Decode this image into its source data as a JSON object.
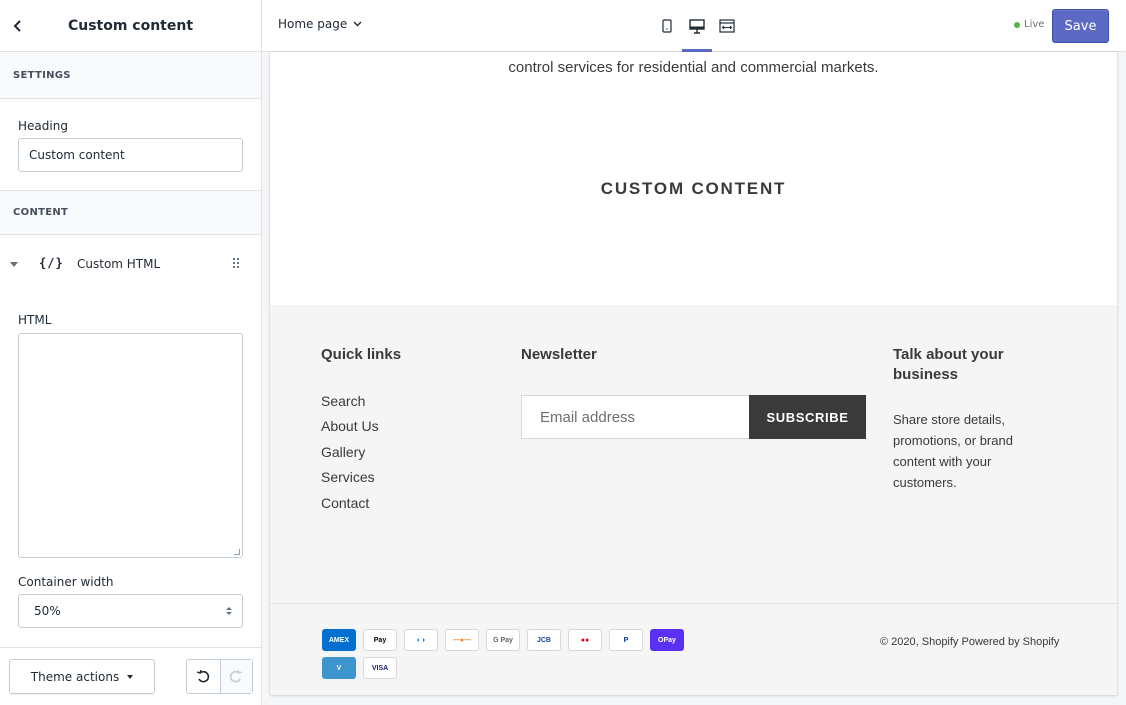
{
  "sidebar": {
    "title": "Custom content",
    "settings_label": "SETTINGS",
    "heading_label": "Heading",
    "heading_value": "Custom content",
    "content_label": "CONTENT",
    "block_glyph": "{/}",
    "block_name": "Custom HTML",
    "html_label": "HTML",
    "html_value": "",
    "container_width_label": "Container width",
    "container_width_value": "50%",
    "theme_actions_label": "Theme actions"
  },
  "topbar": {
    "page_select": "Home page",
    "live_label": "Live",
    "save_label": "Save",
    "active_device": "desktop"
  },
  "preview": {
    "top_text": "control services for residential and commercial markets.",
    "heading": "CUSTOM CONTENT",
    "footer": {
      "quick_links_title": "Quick links",
      "quick_links": [
        "Search",
        "About Us",
        "Gallery",
        "Services",
        "Contact"
      ],
      "newsletter_title": "Newsletter",
      "email_placeholder": "Email address",
      "subscribe_label": "SUBSCRIBE",
      "talk_title": "Talk about your business",
      "talk_text": "Share store details, promotions, or brand content with your customers.",
      "copyright": "© 2020, Shopify",
      "powered_by": "Powered by Shopify",
      "payment_methods": [
        {
          "name": "American Express",
          "label": "AMEX",
          "bg": "#016fd0",
          "fg": "#ffffff"
        },
        {
          "name": "Apple Pay",
          "label": "Pay",
          "bg": "#ffffff",
          "fg": "#000000"
        },
        {
          "name": "Diners Club",
          "label": "◐◑",
          "bg": "#ffffff",
          "fg": "#0079be"
        },
        {
          "name": "Discover",
          "label": "—●—",
          "bg": "#ffffff",
          "fg": "#f58220"
        },
        {
          "name": "Google Pay",
          "label": "G Pay",
          "bg": "#ffffff",
          "fg": "#5f6368"
        },
        {
          "name": "JCB",
          "label": "JCB",
          "bg": "#ffffff",
          "fg": "#0e4c96"
        },
        {
          "name": "Mastercard",
          "label": "●●",
          "bg": "#ffffff",
          "fg": "#eb001b"
        },
        {
          "name": "PayPal",
          "label": "P",
          "bg": "#ffffff",
          "fg": "#003087"
        },
        {
          "name": "Shop Pay",
          "label": "OPay",
          "bg": "#5a31f4",
          "fg": "#ffffff"
        },
        {
          "name": "Venmo",
          "label": "V",
          "bg": "#3d95ce",
          "fg": "#ffffff"
        },
        {
          "name": "Visa",
          "label": "VISA",
          "bg": "#ffffff",
          "fg": "#1a1f71"
        }
      ]
    }
  },
  "colors": {
    "accent": "#5c6ac4",
    "live_dot": "#50b83c",
    "footer_bg": "#f5f5f5",
    "button_dark": "#3a3a3a"
  }
}
